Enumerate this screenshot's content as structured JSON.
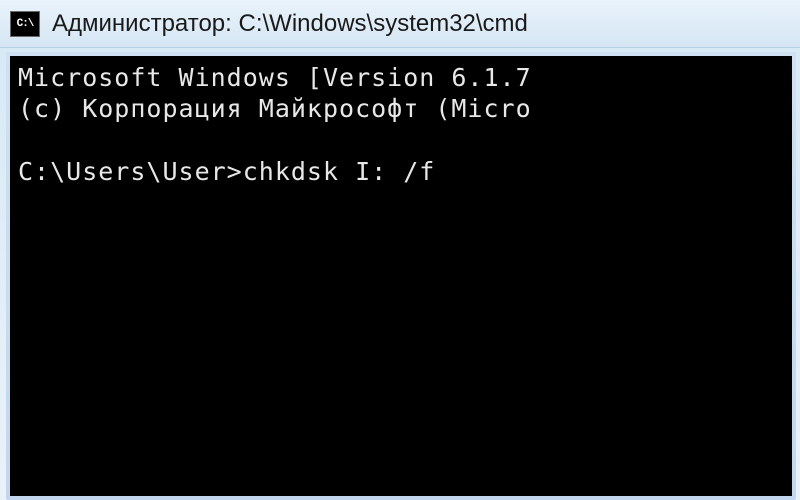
{
  "window": {
    "icon_label": "C:\\",
    "title": "Администратор: C:\\Windows\\system32\\cmd"
  },
  "terminal": {
    "line1": "Microsoft Windows [Version 6.1.7",
    "line2": "(с) Корпорация Майкрософт (Micro",
    "blank": "",
    "prompt": "C:\\Users\\User>",
    "command": "chkdsk I: /f"
  }
}
